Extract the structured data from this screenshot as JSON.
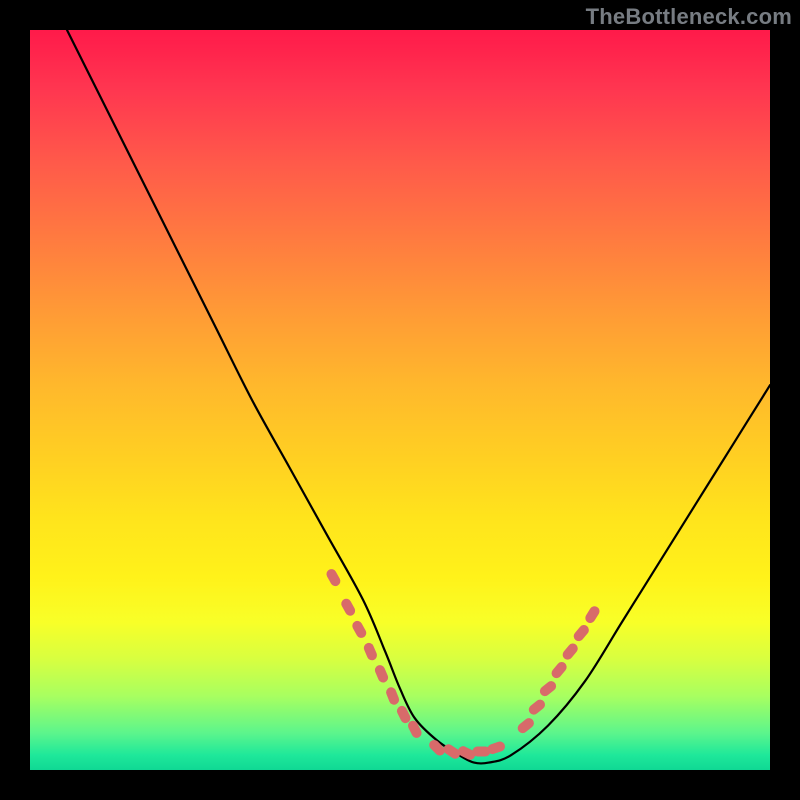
{
  "attribution": "TheBottleneck.com",
  "chart_data": {
    "type": "line",
    "title": "",
    "xlabel": "",
    "ylabel": "",
    "xlim": [
      0,
      100
    ],
    "ylim": [
      0,
      100
    ],
    "grid": false,
    "legend": false,
    "series": [
      {
        "name": "bottleneck-curve",
        "x": [
          5,
          10,
          15,
          20,
          25,
          30,
          35,
          40,
          45,
          48,
          50,
          52,
          55,
          58,
          60,
          62,
          65,
          70,
          75,
          80,
          85,
          90,
          95,
          100
        ],
        "y": [
          100,
          90,
          80,
          70,
          60,
          50,
          41,
          32,
          23,
          16,
          11,
          7,
          4,
          2,
          1,
          1,
          2,
          6,
          12,
          20,
          28,
          36,
          44,
          52
        ]
      }
    ],
    "markers": [
      {
        "name": "left-descent-markers",
        "color": "#d86a6a",
        "points": [
          {
            "x": 41,
            "y": 26
          },
          {
            "x": 43,
            "y": 22
          },
          {
            "x": 44.5,
            "y": 19
          },
          {
            "x": 46,
            "y": 16
          },
          {
            "x": 47.5,
            "y": 13
          },
          {
            "x": 49,
            "y": 10
          },
          {
            "x": 50.5,
            "y": 7.5
          },
          {
            "x": 52,
            "y": 5.5
          }
        ]
      },
      {
        "name": "trough-markers",
        "color": "#d86a6a",
        "points": [
          {
            "x": 55,
            "y": 3
          },
          {
            "x": 57,
            "y": 2.5
          },
          {
            "x": 59,
            "y": 2.3
          },
          {
            "x": 61,
            "y": 2.5
          },
          {
            "x": 63,
            "y": 3
          }
        ]
      },
      {
        "name": "right-ascent-markers",
        "color": "#d86a6a",
        "points": [
          {
            "x": 67,
            "y": 6
          },
          {
            "x": 68.5,
            "y": 8.5
          },
          {
            "x": 70,
            "y": 11
          },
          {
            "x": 71.5,
            "y": 13.5
          },
          {
            "x": 73,
            "y": 16
          },
          {
            "x": 74.5,
            "y": 18.5
          },
          {
            "x": 76,
            "y": 21
          }
        ]
      }
    ],
    "background": {
      "type": "vertical-gradient",
      "stops": [
        {
          "pos": 0,
          "color": "#ff1a4a"
        },
        {
          "pos": 50,
          "color": "#ffc824"
        },
        {
          "pos": 80,
          "color": "#f2ff2a"
        },
        {
          "pos": 100,
          "color": "#14d894"
        }
      ]
    }
  }
}
